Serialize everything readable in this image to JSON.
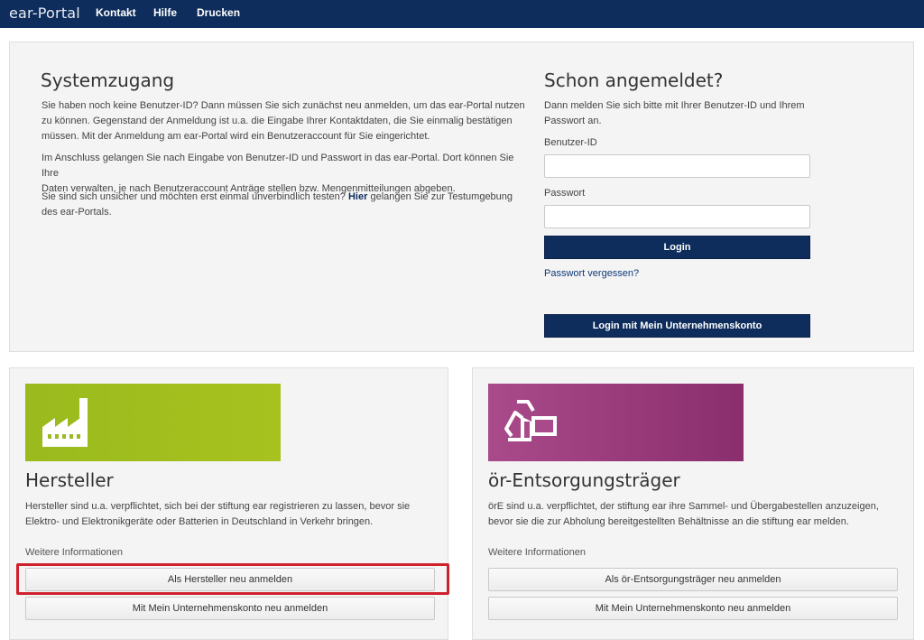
{
  "nav": {
    "brand": "ear-Portal",
    "links": [
      "Kontakt",
      "Hilfe",
      "Drucken"
    ]
  },
  "system_access": {
    "title": "Systemzugang",
    "p1_line1": "Sie haben noch keine Benutzer-ID? Dann müssen Sie sich zunächst neu anmelden, um das ear-Portal nutzen",
    "p1_line2": "zu können. Gegenstand der Anmeldung ist u.a. die Eingabe Ihrer Kontaktdaten, die Sie einmalig bestätigen",
    "p1_line3": "müssen. Mit der Anmeldung am ear-Portal wird ein Benutzeraccount für Sie eingerichtet.",
    "p2_line1": "Im Anschluss gelangen Sie nach Eingabe von Benutzer-ID und Passwort in das ear-Portal. Dort können Sie Ihre",
    "p2_line2": "Daten verwalten, je nach Benutzeraccount Anträge stellen bzw. Mengenmitteilungen abgeben.",
    "p3_pre": "Sie sind sich unsicher und möchten erst einmal unverbindlich testen?",
    "p3_link": "Hier",
    "p3_post": "gelangen Sie zur Testumgebung",
    "p3_line2": "des ear-Portals."
  },
  "login": {
    "title": "Schon angemeldet?",
    "intro_line1": "Dann melden Sie sich bitte mit Ihrer Benutzer-ID und Ihrem",
    "intro_line2": "Passwort an.",
    "user_label": "Benutzer-ID",
    "user_value": "",
    "password_label": "Passwort",
    "password_value": "",
    "login_button": "Login",
    "forgot_link": "Passwort vergessen?",
    "company_login_button": "Login mit Mein Unternehmenskonto"
  },
  "manufacturer": {
    "icon": "factory-icon",
    "color": "#9aba1e",
    "title": "Hersteller",
    "desc_line1": "Hersteller sind u.a. verpflichtet, sich bei der stiftung ear registrieren zu lassen, bevor sie",
    "desc_line2": "Elektro- und Elektronikgeräte oder Batterien in Deutschland in Verkehr bringen.",
    "more_info": "Weitere Informationen",
    "register_button": "Als Hersteller neu anmelden",
    "company_register_button": "Mit Mein Unternehmenskonto neu anmelden"
  },
  "disposal": {
    "icon": "container-recycle-icon",
    "color": "#a94a8a",
    "title": "ör-Entsorgungsträger",
    "desc_line1": "örE sind u.a. verpflichtet, der stiftung ear ihre Sammel- und Übergabestellen anzuzeigen,",
    "desc_line2": "bevor sie die zur Abholung bereitgestellten Behältnisse an die stiftung ear melden.",
    "more_info": "Weitere Informationen",
    "register_button": "Als ör-Entsorgungsträger neu anmelden",
    "company_register_button": "Mit Mein Unternehmenskonto neu anmelden"
  },
  "highlight_color": "#d0202c"
}
